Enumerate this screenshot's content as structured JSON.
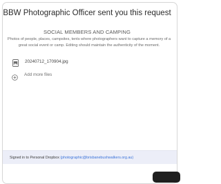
{
  "request": {
    "title": "BBW Photographic Officer sent you this request",
    "subtitle": "SOCIAL MEMBERS AND CAMPING",
    "description": "Photos of people, places, campsites, tents where photographers want to capture a memory of a great social event or camp. Editing should maintain the authenticity of the moment."
  },
  "files": [
    {
      "name": "20240712_170904.jpg",
      "icon": "image-file-icon"
    }
  ],
  "add_files": {
    "label": "Add more files",
    "icon": "plus-circle-icon"
  },
  "footer": {
    "signed_in_prefix": "Signed in to Personal Dropbox",
    "email": "(photographic@brisbanebushwalkers.org.au)"
  },
  "colors": {
    "accent": "#3b73d9",
    "footer_background": "#eceef8",
    "primary_button": "#1f1f1f"
  }
}
